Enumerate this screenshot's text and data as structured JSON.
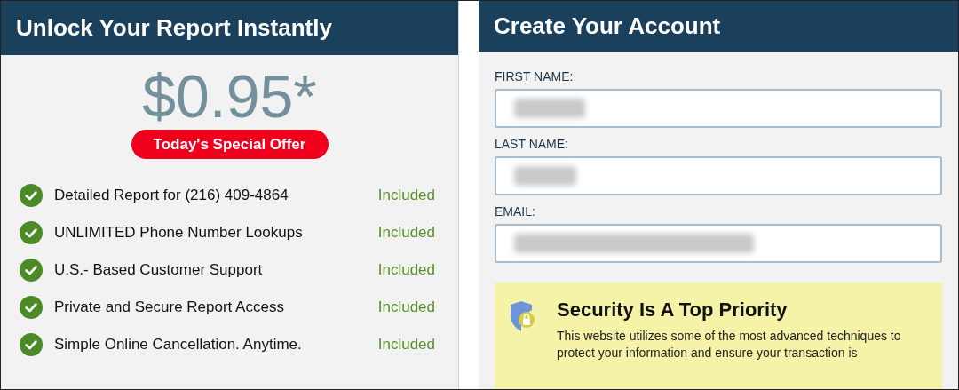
{
  "offer_panel": {
    "title": "Unlock Your Report Instantly",
    "price": "$0.95*",
    "badge": "Today's Special Offer",
    "features": [
      {
        "label": "Detailed Report for (216) 409-4864",
        "status": "Included",
        "checked": true
      },
      {
        "label": "UNLIMITED Phone Number Lookups",
        "status": "Included",
        "checked": true
      },
      {
        "label": "U.S.- Based Customer Support",
        "status": "Included",
        "checked": true
      },
      {
        "label": "Private and Secure Report Access",
        "status": "Included",
        "checked": true
      },
      {
        "label": "Simple Online Cancellation. Anytime.",
        "status": "Included",
        "checked": true
      }
    ]
  },
  "account_panel": {
    "title": "Create Your Account",
    "fields": [
      {
        "label": "FIRST NAME:",
        "redacted": true
      },
      {
        "label": "LAST NAME:",
        "redacted": true
      },
      {
        "label": "EMAIL:",
        "redacted": true
      }
    ],
    "security_notice": {
      "title": "Security Is A Top Priority",
      "text": "This website utilizes some of the most advanced techniques to protect your information and ensure your transaction is"
    }
  }
}
